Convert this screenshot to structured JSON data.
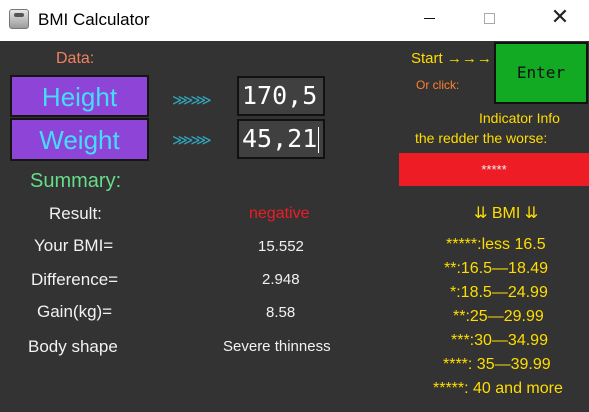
{
  "window": {
    "title": "BMI Calculator",
    "minimize_glyph": "",
    "maximize_glyph": "",
    "close_glyph": "✕"
  },
  "colors": {
    "background": "#333333",
    "button_purple": "#8e44d6",
    "button_text_cyan": "#44ddff",
    "enter_green": "#11aa22",
    "indicator_red": "#ee1c24",
    "yellow_text": "#ffdd00",
    "summary_green": "#66dd88",
    "data_salmon": "#f08060"
  },
  "data_section": {
    "label": "Data:",
    "height_button": "Height",
    "weight_button": "Weight",
    "arrows": "⋙⋙",
    "height_value": "170,5",
    "weight_value": "45,21"
  },
  "summary": {
    "label": "Summary:",
    "rows": [
      {
        "label": "Result:",
        "value": "negative"
      },
      {
        "label": "Your BMI=",
        "value": "15.552"
      },
      {
        "label": "Difference=",
        "value": "2.948"
      },
      {
        "label": "Gain(kg)=",
        "value": "8.58"
      },
      {
        "label": "Body shape",
        "value": "Severe thinness"
      }
    ]
  },
  "controls": {
    "start_label": "Start →→→",
    "or_click": "Or click:",
    "enter_button": "Enter"
  },
  "indicator": {
    "line1": "Indicator Info",
    "line2": "the redder the worse:",
    "level_text": "*****"
  },
  "bmi_legend": {
    "header": "⇊ BMI ⇊",
    "items": [
      "*****:less 16.5",
      "**:16.5—18.49",
      "*:18.5—24.99",
      "**:25—29.99",
      "***:30—34.99",
      "****: 35—39.99",
      "*****: 40 and more"
    ]
  }
}
